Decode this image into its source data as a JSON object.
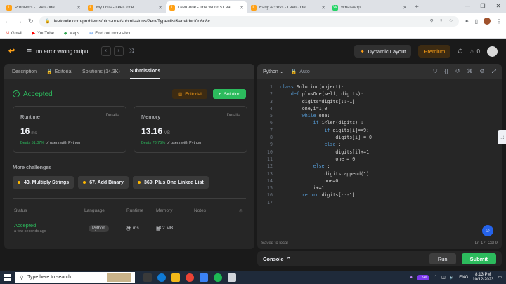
{
  "browser": {
    "tabs": [
      {
        "label": "Problems - LeetCode",
        "fav": "#ffa116",
        "fav_icon": "L"
      },
      {
        "label": "My Lists - LeetCode",
        "fav": "#ffa116",
        "fav_icon": "L"
      },
      {
        "label": "LeetCode - The World's Lea",
        "fav": "#ffa116",
        "fav_icon": "L"
      },
      {
        "label": "Early Access - LeetCode",
        "fav": "#ffa116",
        "fav_icon": "L"
      },
      {
        "label": "WhatsApp",
        "fav": "#25d366",
        "fav_icon": "W"
      }
    ],
    "url": "leetcode.com/problems/plus-one/submissions/?envType=list&envId=rf0o6c8c",
    "bookmarks": [
      "Gmail",
      "YouTube",
      "Maps",
      "Find out more abou..."
    ]
  },
  "header": {
    "problem_title": "no error wrong output",
    "dynamic_layout": "Dynamic Layout",
    "premium": "Premium",
    "streak": "0"
  },
  "left": {
    "tabs": [
      "Description",
      "Editorial",
      "Solutions (14.3K)",
      "Submissions"
    ],
    "status": "Accepted",
    "editorial_btn": "Editorial",
    "solution_btn": "Solution",
    "runtime": {
      "label": "Runtime",
      "details": "Details",
      "value": "16",
      "unit": "ms",
      "beats_pct": "Beats 51.07%",
      "beats_rest": "of users with Python"
    },
    "memory": {
      "label": "Memory",
      "details": "Details",
      "value": "13.16",
      "unit": "MB",
      "beats_pct": "Beats 78.75%",
      "beats_rest": "of users with Python"
    },
    "more_title": "More challenges",
    "challenges": [
      "43. Multiply Strings",
      "67. Add Binary",
      "369. Plus One Linked List"
    ],
    "table_headers": {
      "status": "Status",
      "language": "Language",
      "runtime": "Runtime",
      "memory": "Memory",
      "notes": "Notes"
    },
    "row": {
      "status": "Accepted",
      "ago": "a few seconds ago",
      "language": "Python",
      "runtime": "16 ms",
      "memory": "13.2 MB"
    }
  },
  "editor": {
    "language": "Python",
    "mode": "Auto",
    "saved": "Saved to local",
    "cursor": "Ln 17, Col 9",
    "lines": [
      "class Solution(object):",
      "    def plusOne(self, digits):",
      "        digits=digits[::-1]",
      "        one,i=1,0",
      "        while one:",
      "            if i<len(digits) :",
      "                if digits[i]==9:",
      "                    digits[i] = 0",
      "                else :",
      "                    digits[i]+=1",
      "                    one = 0",
      "            else :",
      "                digits.append(1)",
      "                one=0",
      "            i+=1",
      "        return digits[::-1]",
      ""
    ]
  },
  "bottom": {
    "console": "Console",
    "run": "Run",
    "submit": "Submit"
  },
  "taskbar": {
    "search": "Type here to search",
    "live": "Live",
    "lang": "ENG",
    "time": "8:13 PM",
    "date": "10/12/2023"
  }
}
